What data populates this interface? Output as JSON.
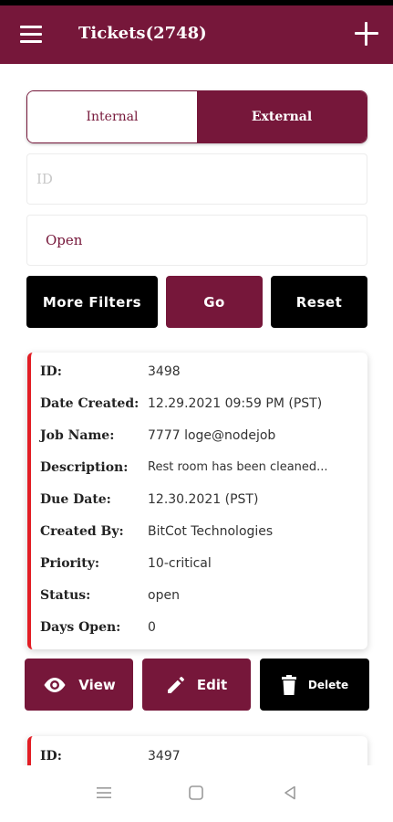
{
  "app": {
    "title": "Tickets(2748)",
    "brand_color": "#76173a",
    "accent_red": "#e21d24"
  },
  "tabs": {
    "internal": "Internal",
    "external": "External",
    "active": "External"
  },
  "filters": {
    "id_placeholder": "ID",
    "status_value": "Open"
  },
  "buttons": {
    "more_filters": "More  Filters",
    "go": "Go",
    "reset": "Reset"
  },
  "ticket_labels": {
    "id": "ID:",
    "date_created": "Date  Created:",
    "job_name": "Job  Name:",
    "description": "Description:",
    "due_date": "Due  Date:",
    "created_by": "Created  By:",
    "priority": "Priority:",
    "status": "Status:",
    "days_open": "Days  Open:"
  },
  "tickets": [
    {
      "id": "3498",
      "date_created": "12.29.2021 09:59 PM (PST)",
      "job_name": "7777 loge@nodejob",
      "description": "Rest room has been cleaned...",
      "due_date": "12.30.2021 (PST)",
      "created_by": "BitCot Technologies",
      "priority": "10-critical",
      "status": "open",
      "days_open": "0"
    },
    {
      "id": "3497"
    }
  ],
  "actions": {
    "view": "View",
    "edit": "Edit",
    "delete": "Delete"
  },
  "icons": {
    "menu": "hamburger-menu-icon",
    "add": "plus-icon",
    "view": "eye-icon",
    "edit": "pencil-icon",
    "delete": "trash-icon",
    "nav_recent": "recent-apps-icon",
    "nav_home": "home-icon",
    "nav_back": "back-icon"
  }
}
